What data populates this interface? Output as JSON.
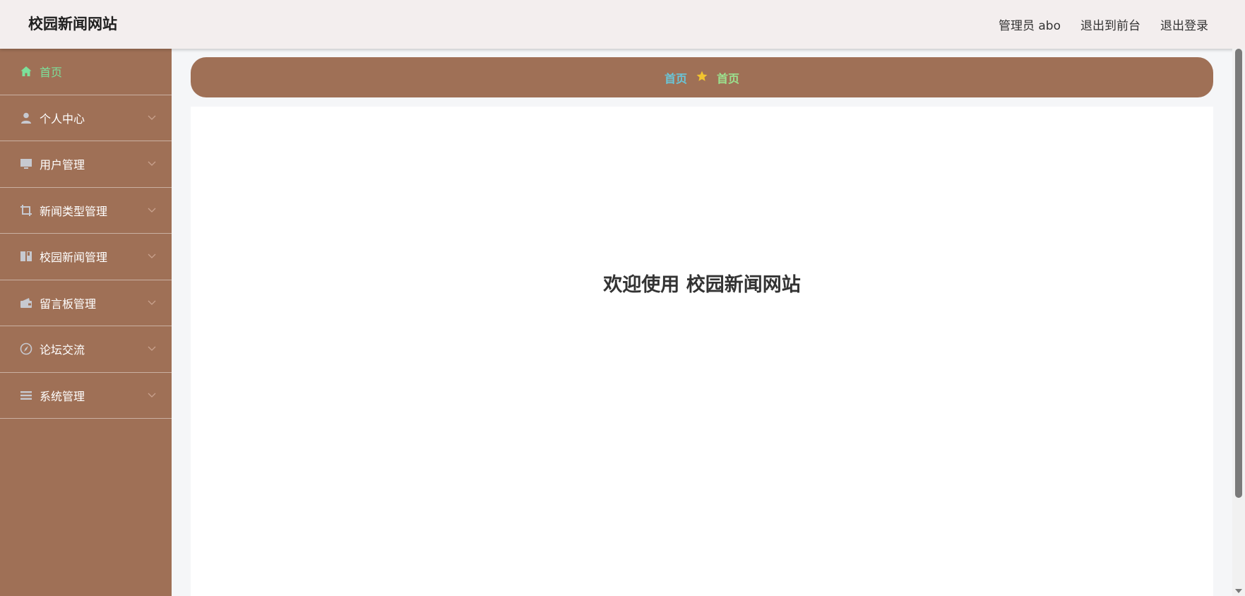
{
  "header": {
    "site_title": "校园新闻网站",
    "admin_label": "管理员 abo",
    "to_frontend": "退出到前台",
    "logout": "退出登录"
  },
  "sidebar": {
    "items": [
      {
        "label": "首页",
        "icon": "home-icon",
        "active": true
      },
      {
        "label": "个人中心",
        "icon": "user-icon"
      },
      {
        "label": "用户管理",
        "icon": "monitor-icon"
      },
      {
        "label": "新闻类型管理",
        "icon": "crop-icon"
      },
      {
        "label": "校园新闻管理",
        "icon": "book-icon"
      },
      {
        "label": "留言板管理",
        "icon": "wallet-icon"
      },
      {
        "label": "论坛交流",
        "icon": "compass-icon"
      },
      {
        "label": "系统管理",
        "icon": "list-icon"
      }
    ]
  },
  "breadcrumb": {
    "home": "首页",
    "current": "首页"
  },
  "main": {
    "welcome": "欢迎使用 校园新闻网站"
  },
  "colors": {
    "sidebar_bg": "#9f7056",
    "header_bg": "#f3eeee",
    "active_menu": "#7ce09a",
    "crumb_home": "#69c6d9",
    "crumb_current": "#9be38f",
    "star": "#f2c42f"
  }
}
